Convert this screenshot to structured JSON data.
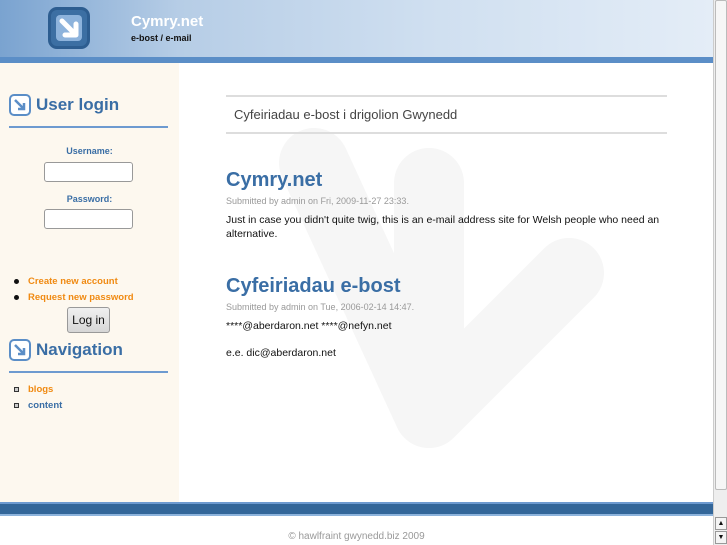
{
  "header": {
    "site_name": "Cymry.net",
    "slogan": "e-bost / e-mail"
  },
  "sidebar": {
    "login": {
      "title": "User login",
      "username_label": "Username:",
      "username_value": "",
      "password_label": "Password:",
      "password_value": "",
      "button": "Log in",
      "links": [
        "Create new account",
        "Request new password"
      ]
    },
    "navigation": {
      "title": "Navigation",
      "items": [
        "blogs",
        "content"
      ]
    }
  },
  "main": {
    "mission": "Cyfeiriadau e-bost i drigolion Gwynedd",
    "nodes": [
      {
        "title": "Cymry.net",
        "submitted": "Submitted by admin on Fri, 2009-11-27 23:33.",
        "body": [
          "Just in case you didn't quite twig, this is an e-mail address site for Welsh people who need an alternative."
        ]
      },
      {
        "title": "Cyfeiriadau e-bost",
        "submitted": "Submitted by admin on Tue, 2006-02-14 14:47.",
        "body": [
          "****@aberdaron.net ****@nefyn.net",
          "e.e. dic@aberdaron.net"
        ]
      }
    ]
  },
  "footer": {
    "text": "© hawlfraint gwynedd.biz 2009"
  },
  "colors": {
    "brand": "#3a6ea5",
    "link": "#f08a12",
    "sidebar_bg": "#fdf8ef"
  }
}
